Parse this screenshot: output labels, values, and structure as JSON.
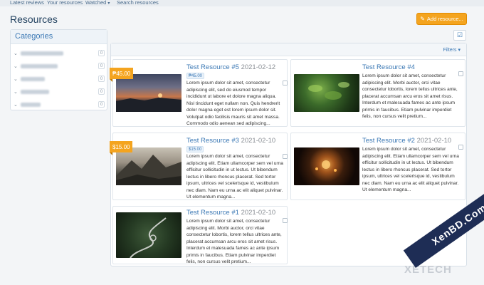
{
  "topnav": {
    "items": [
      "Latest reviews",
      "Your resources",
      "Watched",
      "Search resources"
    ]
  },
  "page": {
    "title": "Resources",
    "add_button": "Add resource..."
  },
  "sidebar": {
    "title": "Categories",
    "counts": [
      "0",
      "0",
      "0",
      "0",
      "0"
    ]
  },
  "main": {
    "filters_label": "Filters"
  },
  "cards": [
    {
      "title": "Test Resource #5",
      "date": "2021-02-12",
      "price": "₱45.00",
      "ribbon": "₱45.00",
      "description": "Lorem ipsum dolor sit amet, consectetur adipiscing elit, sed do eiusmod tempor incididunt ut labore et dolore magna aliqua. Nisl tincidunt eget nullam non. Quis hendrerit dolor magna eget est lorem ipsum dolor sit. Volutpat odio facilisis mauris sit amet massa. Commodo odio aenean sed adipiscing..."
    },
    {
      "title": "Test Resource #4",
      "date": "",
      "price": "",
      "ribbon": "",
      "description": "Lorem ipsum dolor sit amet, consectetur adipiscing elit. Morbi auctor, orci vitae consectetur lobortis, lorem tellus ultrices ante, placerat accumsan arcu eros sit amet risus. Interdum et malesuada fames ac ante ipsum primis in faucibus. Etiam pulvinar imperdiet felis, non cursus velit pretium..."
    },
    {
      "title": "Test Resource #3",
      "date": "2021-02-10",
      "price": "$15.00",
      "ribbon": "$15.00",
      "description": "Lorem ipsum dolor sit amet, consectetur adipiscing elit. Etiam ullamcorper sem vel urna efficitur sollicitudin in ut lectus. Ut bibendum lectus in libero rhoncus placerat. Sed tortor ipsum, ultrices vel scelerisque id, vestibulum nec diam. Nam eu urna ac elit aliquet pulvinar. Ut elementum magna..."
    },
    {
      "title": "Test Resource #2",
      "date": "2021-02-10",
      "price": "",
      "ribbon": "",
      "description": "Lorem ipsum dolor sit amet, consectetur adipiscing elit. Etiam ullamcorper sem vel urna efficitur sollicitudin in ut lectus. Ut bibendum lectus in libero rhoncus placerat. Sed tortor ipsum, ultrices vel scelerisque id, vestibulum nec diam. Nam eu urna ac elit aliquet pulvinar. Ut elementum magna..."
    },
    {
      "title": "Test Resource #1",
      "date": "2021-02-10",
      "price": "",
      "ribbon": "",
      "description": "Lorem ipsum dolor sit amet, consectetur adipiscing elit. Morbi auctor, orci vitae consectetur lobortis, lorem tellus ultrices ante, placerat accumsan arcu eros sit amet risus. Interdum et malesuada fames ac ante ipsum primis in faucibus. Etiam pulvinar imperdiet felis, non cursus velit pretium..."
    }
  ],
  "watermark": {
    "text": "XenBD.Com",
    "text2": "XETECH"
  }
}
